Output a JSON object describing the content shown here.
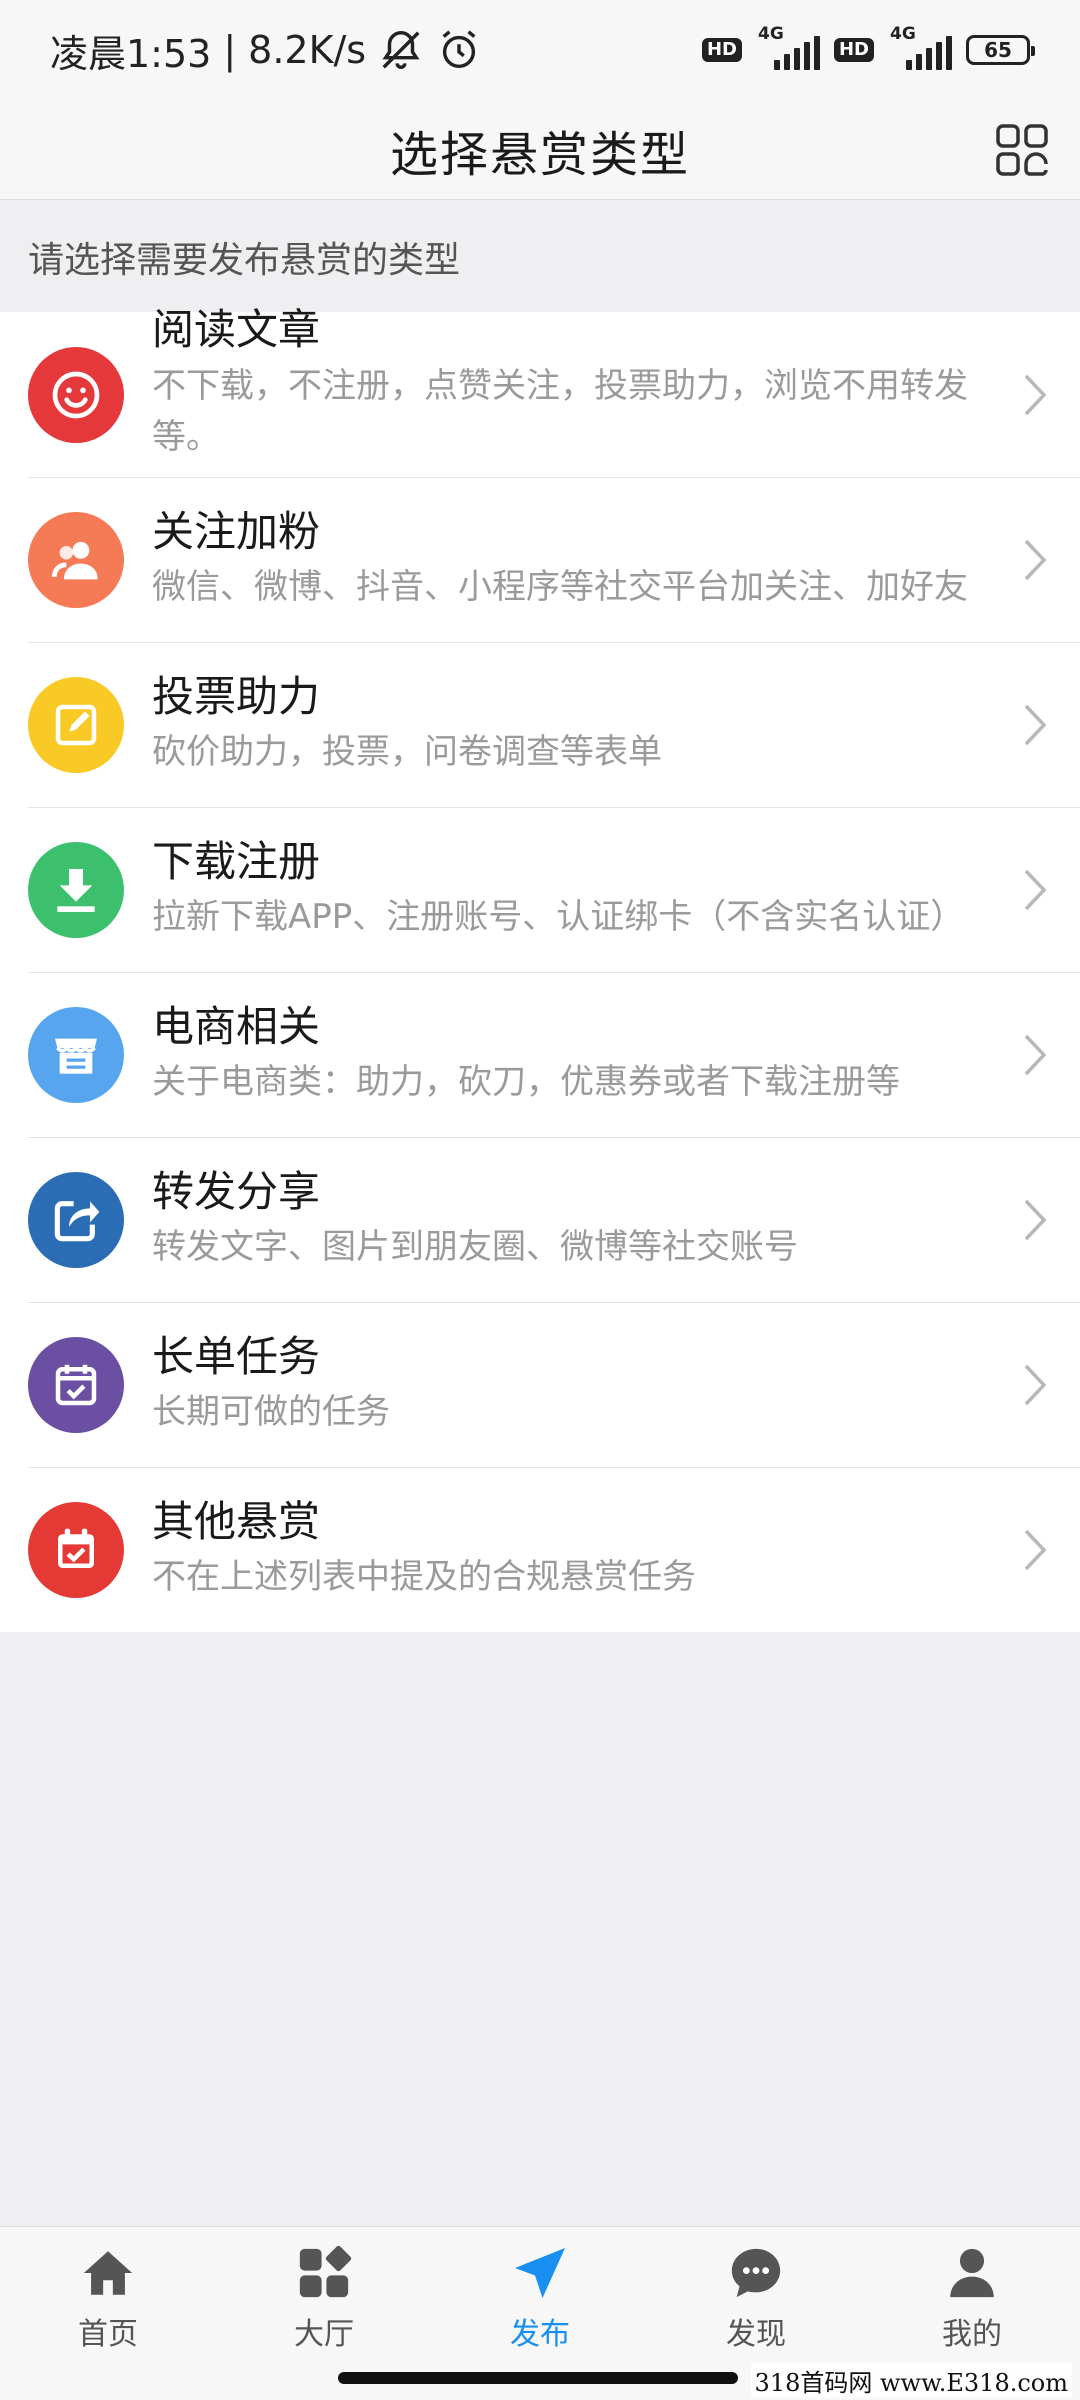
{
  "status_bar": {
    "time": "凌晨1:53",
    "separator": "|",
    "speed": "8.2K/s",
    "hd1": "HD",
    "net1": "4G",
    "hd2": "HD",
    "net2": "4G",
    "battery": "65"
  },
  "header": {
    "title": "选择悬赏类型"
  },
  "section": {
    "hint": "请选择需要发布悬赏的类型"
  },
  "items": [
    {
      "title": "阅读文章",
      "desc": "不下载，不注册，点赞关注，投票助力，浏览不用转发等。",
      "color": "#e5383b",
      "icon": "smile-icon"
    },
    {
      "title": "关注加粉",
      "desc": "微信、微博、抖音、小程序等社交平台加关注、加好友",
      "color": "#f47b55",
      "icon": "users-icon"
    },
    {
      "title": "投票助力",
      "desc": "砍价助力，投票，问卷调查等表单",
      "color": "#f9c926",
      "icon": "edit-icon"
    },
    {
      "title": "下载注册",
      "desc": "拉新下载APP、注册账号、认证绑卡（不含实名认证）",
      "color": "#3cc06e",
      "icon": "download-icon"
    },
    {
      "title": "电商相关",
      "desc": "关于电商类：助力，砍刀，优惠券或者下载注册等",
      "color": "#57a5ee",
      "icon": "store-icon"
    },
    {
      "title": "转发分享",
      "desc": "转发文字、图片到朋友圈、微博等社交账号",
      "color": "#2b6db5",
      "icon": "share-icon"
    },
    {
      "title": "长单任务",
      "desc": "长期可做的任务",
      "color": "#6b4fa3",
      "icon": "calendar-check-icon"
    },
    {
      "title": "其他悬赏",
      "desc": "不在上述列表中提及的合规悬赏任务",
      "color": "#e53935",
      "icon": "calendar-check-icon"
    }
  ],
  "nav": [
    {
      "label": "首页",
      "icon": "home-icon"
    },
    {
      "label": "大厅",
      "icon": "apps-icon"
    },
    {
      "label": "发布",
      "icon": "send-icon",
      "active": true
    },
    {
      "label": "发现",
      "icon": "chat-icon"
    },
    {
      "label": "我的",
      "icon": "person-icon"
    }
  ],
  "colors": {
    "accent": "#1a8ff2",
    "nav_inactive": "#555555"
  },
  "watermark": "318首码网  www.E318.com"
}
